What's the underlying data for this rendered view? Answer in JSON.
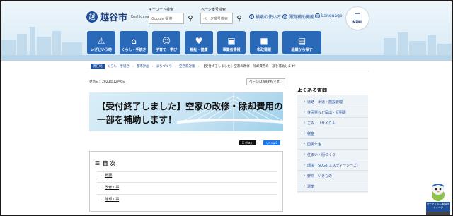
{
  "site": {
    "name": "越谷市",
    "name_en": "Koshigaya City"
  },
  "header": {
    "keyword_search_label": "キーワード検索",
    "keyword_search_placeholder": "Google 提供",
    "page_number_search_label": "ページ番号検索",
    "page_number_search_placeholder": "ページ番号検索",
    "links": [
      {
        "label": "検索の使い方",
        "icon": "question-icon"
      },
      {
        "label": "閲覧補助機能",
        "icon": "gear-icon"
      },
      {
        "label": "Language",
        "icon": "globe-icon"
      }
    ],
    "menu_label": "MENU"
  },
  "nav": [
    {
      "label": "いざという時",
      "icon": "alert-icon"
    },
    {
      "label": "くらし・手続き",
      "icon": "house-icon"
    },
    {
      "label": "子育て・学び",
      "icon": "child-icon"
    },
    {
      "label": "福祉・健康",
      "icon": "health-icon"
    },
    {
      "label": "事業者情報",
      "icon": "briefcase-icon"
    },
    {
      "label": "市政情報",
      "icon": "cityhall-icon"
    },
    {
      "label": "組織から探す",
      "icon": "organization-icon"
    }
  ],
  "breadcrumb": {
    "home": "現在地",
    "items": [
      "くらし・手続き",
      "都市計画",
      "まちづくり",
      "空き家対策"
    ],
    "current": "【受付終了しました】空家の改修・除却費用の一部を補助します！"
  },
  "article": {
    "updated": "更新日：2023年12月6日",
    "page_id": "ページID:99899です。",
    "title": "【受付終了しました】空家の改修・除却費用の一部を補助します！",
    "share_x": "X ポスト",
    "share_fb": "いいね 0"
  },
  "toc": {
    "title": "目 次",
    "items": [
      "概要",
      "改修工事",
      "除却工事"
    ]
  },
  "sidebar": {
    "title": "よくある質問",
    "items": [
      "道路・水道・施設管理",
      "住民票など届出・証明書",
      "ごみ・リサイクル",
      "税金",
      "国民年金",
      "住まい・街づくり",
      "環境・SDGs(エスディージーズ)",
      "野鳥・いきもの",
      "選挙"
    ]
  },
  "mascot": {
    "banner": "ガーヤちゃん\n越谷市イメージ"
  },
  "colors": {
    "nav": "#2a69b8",
    "brand": "#1f4f99"
  }
}
